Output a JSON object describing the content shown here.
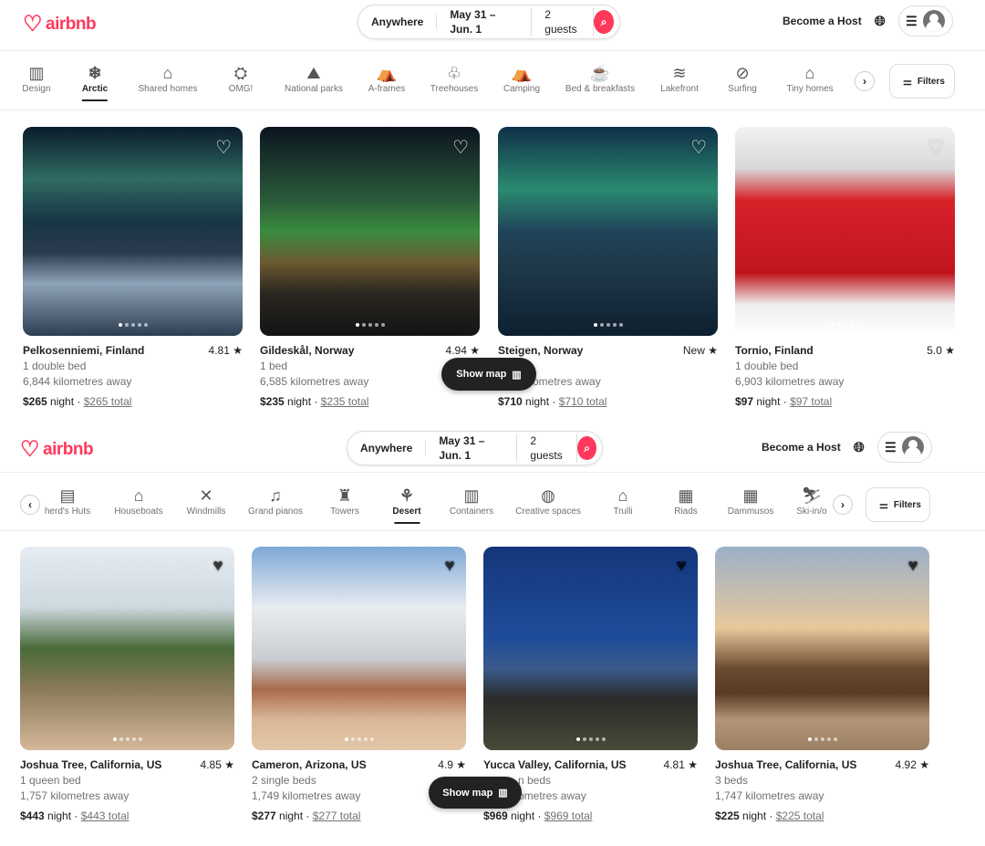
{
  "brand": {
    "name": "airbnb",
    "color": "#ff385c"
  },
  "screens": [
    {
      "header": {
        "search": {
          "where": "Anywhere",
          "when": "May 31 – Jun. 1",
          "who": "2 guests"
        },
        "become_host": "Become a Host"
      },
      "categories": [
        {
          "label": "Design",
          "icon": "design-icon"
        },
        {
          "label": "Arctic",
          "icon": "snowflake-icon",
          "active": true
        },
        {
          "label": "Shared homes",
          "icon": "shared-home-icon"
        },
        {
          "label": "OMG!",
          "icon": "ufo-icon"
        },
        {
          "label": "National parks",
          "icon": "national-park-icon"
        },
        {
          "label": "A-frames",
          "icon": "a-frame-icon"
        },
        {
          "label": "Treehouses",
          "icon": "treehouse-icon"
        },
        {
          "label": "Camping",
          "icon": "camping-icon"
        },
        {
          "label": "Bed & breakfasts",
          "icon": "coffee-mug-icon"
        },
        {
          "label": "Lakefront",
          "icon": "lakefront-icon"
        },
        {
          "label": "Surfing",
          "icon": "surfboard-icon"
        },
        {
          "label": "Tiny homes",
          "icon": "tiny-home-icon"
        }
      ],
      "filters_label": "Filters",
      "show_map": "Show map",
      "listings": [
        {
          "title": "Pelkosenniemi, Finland",
          "rating": "4.81",
          "line1": "1 double bed",
          "line2": "6,844 kilometres away",
          "price": "$265",
          "night": "night",
          "total": "$265 total"
        },
        {
          "title": "Gildeskål, Norway",
          "rating": "4.94",
          "line1": "1 bed",
          "line2": "6,585 kilometres away",
          "price": "$235",
          "night": "night",
          "total": "$235 total"
        },
        {
          "title": "Steigen, Norway",
          "rating": "New",
          "line1": "",
          "line2": "ometres away",
          "price": "$710",
          "night": "night",
          "total": "$710 total"
        },
        {
          "title": "Tornio, Finland",
          "rating": "5.0",
          "line1": "1 double bed",
          "line2": "6,903 kilometres away",
          "price": "$97",
          "night": "night",
          "total": "$97 total"
        }
      ]
    },
    {
      "header": {
        "search": {
          "where": "Anywhere",
          "when": "May 31 – Jun. 1",
          "who": "2 guests"
        },
        "become_host": "Become a Host"
      },
      "categories": [
        {
          "label": "herd's Huts",
          "icon": "shepherds-hut-icon"
        },
        {
          "label": "Houseboats",
          "icon": "houseboat-icon"
        },
        {
          "label": "Windmills",
          "icon": "windmill-icon"
        },
        {
          "label": "Grand pianos",
          "icon": "piano-icon"
        },
        {
          "label": "Towers",
          "icon": "tower-icon"
        },
        {
          "label": "Desert",
          "icon": "cactus-icon",
          "active": true
        },
        {
          "label": "Containers",
          "icon": "container-icon"
        },
        {
          "label": "Creative spaces",
          "icon": "palette-icon"
        },
        {
          "label": "Trulli",
          "icon": "trullo-icon"
        },
        {
          "label": "Riads",
          "icon": "riad-icon"
        },
        {
          "label": "Dammusos",
          "icon": "dammuso-icon"
        },
        {
          "label": "Ski-in/o",
          "icon": "ski-icon"
        }
      ],
      "filters_label": "Filters",
      "show_map": "Show map",
      "listings": [
        {
          "title": "Joshua Tree, California, US",
          "rating": "4.85",
          "line1": "1 queen bed",
          "line2": "1,757 kilometres away",
          "price": "$443",
          "night": "night",
          "total": "$443 total"
        },
        {
          "title": "Cameron, Arizona, US",
          "rating": "4.9",
          "line1": "2 single beds",
          "line2": "1,749 kilometres away",
          "price": "$277",
          "night": "night",
          "total": "$277 total"
        },
        {
          "title": "Yucca Valley, California, US",
          "rating": "4.81",
          "line1": "n beds",
          "line2": "ometres away",
          "price": "$969",
          "night": "night",
          "total": "$969 total"
        },
        {
          "title": "Joshua Tree, California, US",
          "rating": "4.92",
          "line1": "3 beds",
          "line2": "1,747 kilometres away",
          "price": "$225",
          "night": "night",
          "total": "$225 total"
        }
      ]
    }
  ]
}
